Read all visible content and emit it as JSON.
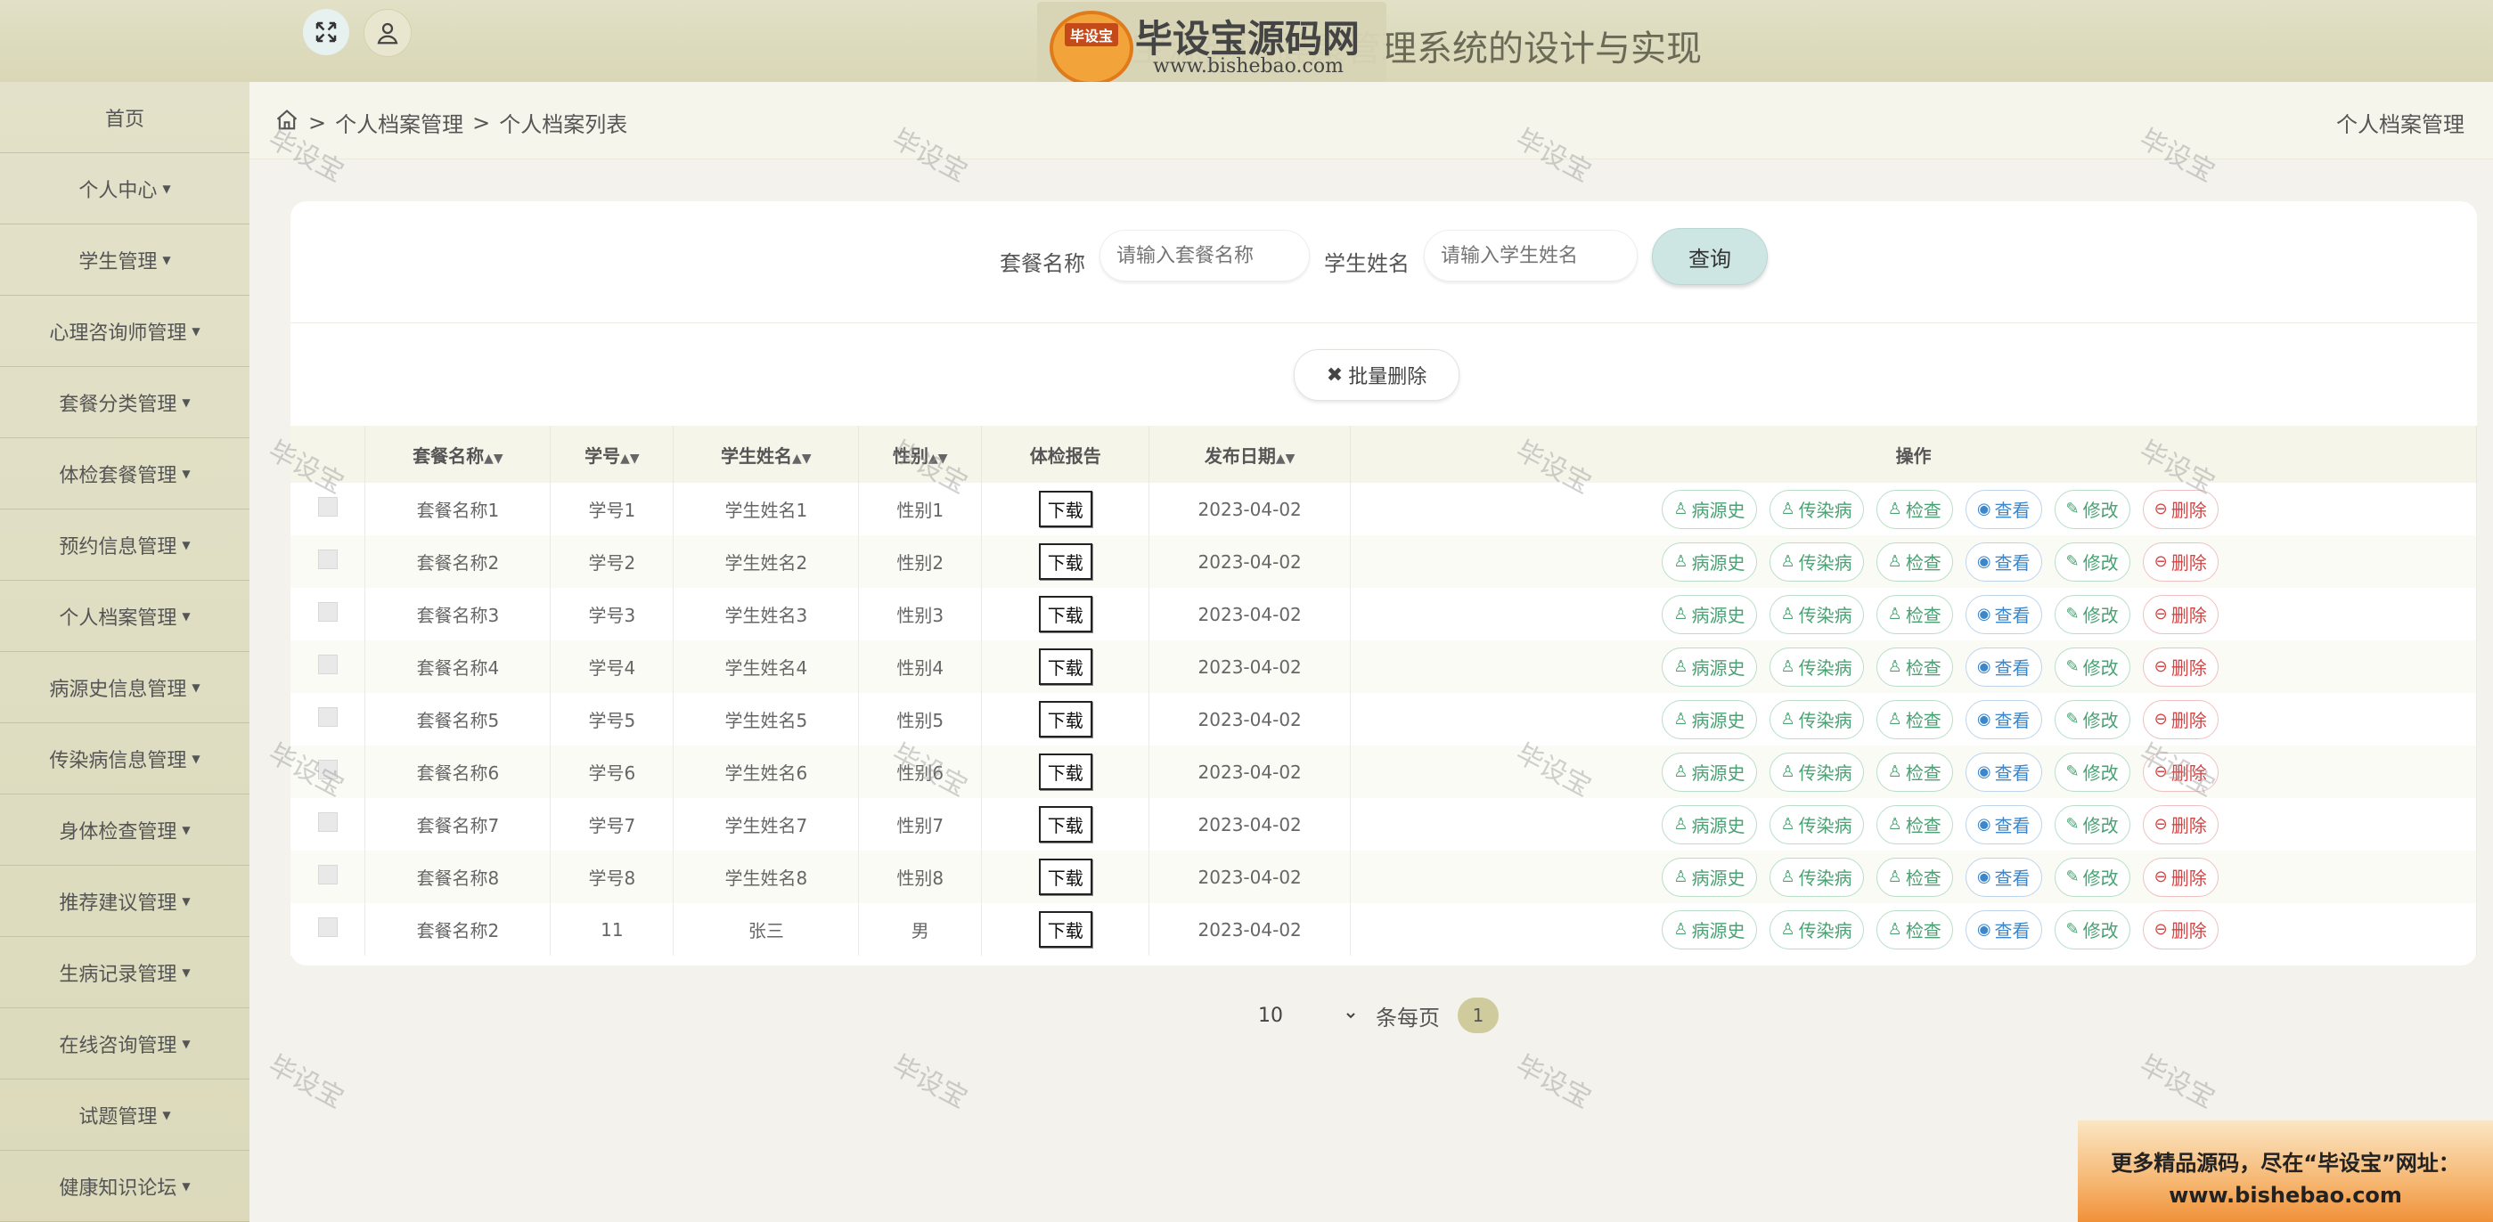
{
  "header": {
    "title": "毕设宝源码网健康管理系统的设计与实现",
    "logo_badge": "毕设宝",
    "logo_name": "毕设宝源码网",
    "logo_url": "www.bishebao.com"
  },
  "sidebar": {
    "items": [
      {
        "label": "首页",
        "dropdown": false
      },
      {
        "label": "个人中心",
        "dropdown": true
      },
      {
        "label": "学生管理",
        "dropdown": true
      },
      {
        "label": "心理咨询师管理",
        "dropdown": true
      },
      {
        "label": "套餐分类管理",
        "dropdown": true
      },
      {
        "label": "体检套餐管理",
        "dropdown": true
      },
      {
        "label": "预约信息管理",
        "dropdown": true
      },
      {
        "label": "个人档案管理",
        "dropdown": true
      },
      {
        "label": "病源史信息管理",
        "dropdown": true
      },
      {
        "label": "传染病信息管理",
        "dropdown": true
      },
      {
        "label": "身体检查管理",
        "dropdown": true
      },
      {
        "label": "推荐建议管理",
        "dropdown": true
      },
      {
        "label": "生病记录管理",
        "dropdown": true
      },
      {
        "label": "在线咨询管理",
        "dropdown": true
      },
      {
        "label": "试题管理",
        "dropdown": true
      },
      {
        "label": "健康知识论坛",
        "dropdown": true
      }
    ]
  },
  "breadcrumb": {
    "items": [
      "个人档案管理",
      "个人档案列表"
    ],
    "right_title": "个人档案管理"
  },
  "search": {
    "field1_label": "套餐名称",
    "field1_placeholder": "请输入套餐名称",
    "field2_label": "学生姓名",
    "field2_placeholder": "请输入学生姓名",
    "button": "查询"
  },
  "batch_delete": "批量删除",
  "table": {
    "columns": [
      "套餐名称",
      "学号",
      "学生姓名",
      "性别",
      "体检报告",
      "发布日期",
      "操作"
    ],
    "download_label": "下载",
    "actions": [
      "病源史",
      "传染病",
      "检查",
      "查看",
      "修改",
      "删除"
    ],
    "rows": [
      {
        "package": "套餐名称1",
        "sid": "学号1",
        "name": "学生姓名1",
        "gender": "性别1",
        "date": "2023-04-02"
      },
      {
        "package": "套餐名称2",
        "sid": "学号2",
        "name": "学生姓名2",
        "gender": "性别2",
        "date": "2023-04-02"
      },
      {
        "package": "套餐名称3",
        "sid": "学号3",
        "name": "学生姓名3",
        "gender": "性别3",
        "date": "2023-04-02"
      },
      {
        "package": "套餐名称4",
        "sid": "学号4",
        "name": "学生姓名4",
        "gender": "性别4",
        "date": "2023-04-02"
      },
      {
        "package": "套餐名称5",
        "sid": "学号5",
        "name": "学生姓名5",
        "gender": "性别5",
        "date": "2023-04-02"
      },
      {
        "package": "套餐名称6",
        "sid": "学号6",
        "name": "学生姓名6",
        "gender": "性别6",
        "date": "2023-04-02"
      },
      {
        "package": "套餐名称7",
        "sid": "学号7",
        "name": "学生姓名7",
        "gender": "性别7",
        "date": "2023-04-02"
      },
      {
        "package": "套餐名称8",
        "sid": "学号8",
        "name": "学生姓名8",
        "gender": "性别8",
        "date": "2023-04-02"
      },
      {
        "package": "套餐名称2",
        "sid": "11",
        "name": "张三",
        "gender": "男",
        "date": "2023-04-02"
      }
    ]
  },
  "pagination": {
    "page_size": "10",
    "page_size_options": [
      "10"
    ],
    "per_page_label": "条每页",
    "current_page": "1"
  },
  "watermark": "毕设宝",
  "promo": {
    "line1": "更多精品源码，尽在“毕设宝”网址：",
    "line2": "www.bishebao.com"
  },
  "colors": {
    "sidebar_bg": "#dedcbe",
    "header_bg": "#d9d7b6",
    "query_button": "#cde6e3",
    "action_green": "#4aa173",
    "action_blue": "#3d86c9",
    "action_red": "#d24646",
    "page_active": "#cfcb9c"
  }
}
